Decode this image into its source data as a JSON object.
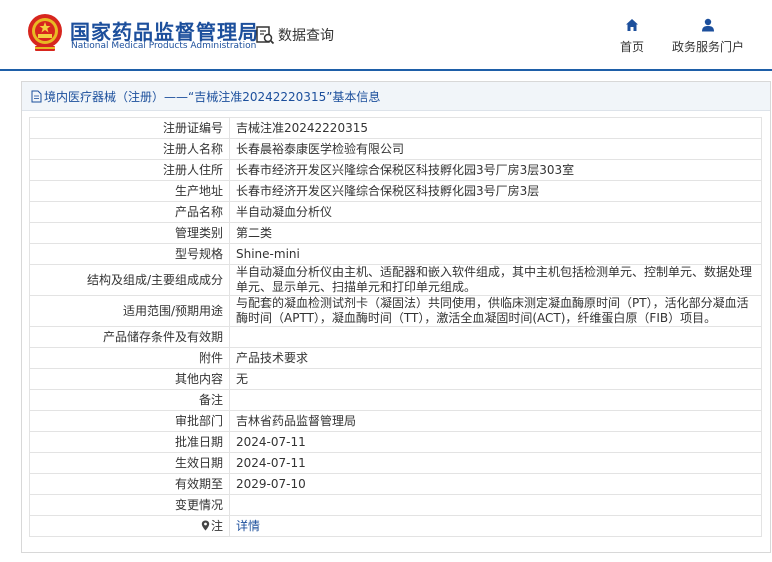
{
  "header": {
    "brand_cn": "国家药品监督管理局",
    "brand_en": "National Medical Products Administration",
    "query_label": "数据查询",
    "nav": {
      "home": "首页",
      "gov_portal": "政务服务门户"
    },
    "accent_color": "#1e5fa8",
    "icons": {
      "emblem": "national-emblem-icon",
      "query": "search-document-icon",
      "home": "home-icon",
      "user": "user-icon"
    }
  },
  "breadcrumb": {
    "link": "境内医疗器械（注册）",
    "rest": "——“吉械注准20242220315”基本信息"
  },
  "rows": [
    {
      "key": "注册证编号",
      "value": "吉械注准20242220315"
    },
    {
      "key": "注册人名称",
      "value": "长春晨裕泰康医学检验有限公司"
    },
    {
      "key": "注册人住所",
      "value": "长春市经济开发区兴隆综合保税区科技孵化园3号厂房3层303室"
    },
    {
      "key": "生产地址",
      "value": "长春市经济开发区兴隆综合保税区科技孵化园3号厂房3层"
    },
    {
      "key": "产品名称",
      "value": "半自动凝血分析仪"
    },
    {
      "key": "管理类别",
      "value": "第二类"
    },
    {
      "key": "型号规格",
      "value": "Shine-mini"
    },
    {
      "key": "结构及组成/主要组成成分",
      "value": "半自动凝血分析仪由主机、适配器和嵌入软件组成，其中主机包括检测单元、控制单元、数据处理单元、显示单元、扫描单元和打印单元组成。"
    },
    {
      "key": "适用范围/预期用途",
      "value": "与配套的凝血检测试剂卡（凝固法）共同使用，供临床测定凝血酶原时间（PT），活化部分凝血活酶时间（APTT），凝血酶时间（TT），激活全血凝固时间(ACT)，纤维蛋白原（FIB）项目。"
    },
    {
      "key": "产品储存条件及有效期",
      "value": ""
    },
    {
      "key": "附件",
      "value": "产品技术要求"
    },
    {
      "key": "其他内容",
      "value": "无"
    },
    {
      "key": "备注",
      "value": ""
    },
    {
      "key": "审批部门",
      "value": "吉林省药品监督管理局"
    },
    {
      "key": "批准日期",
      "value": "2024-07-11"
    },
    {
      "key": "生效日期",
      "value": "2024-07-11"
    },
    {
      "key": "有效期至",
      "value": "2029-07-10"
    },
    {
      "key": "变更情况",
      "value": ""
    }
  ],
  "note_row": {
    "key": "注",
    "link": "详情",
    "icon": "location-pin-icon"
  }
}
